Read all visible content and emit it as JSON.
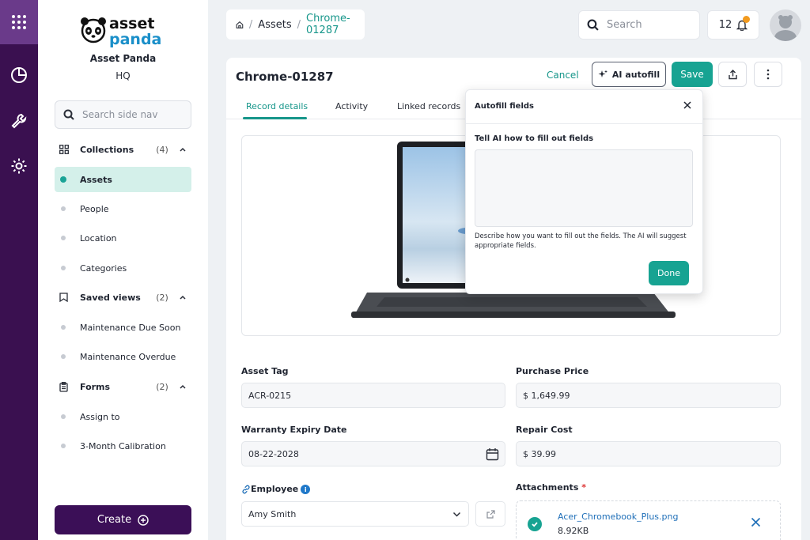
{
  "org": {
    "logo_line1": "asset",
    "logo_line2": "panda",
    "name": "Asset Panda",
    "location": "HQ"
  },
  "sidenav": {
    "search_placeholder": "Search side nav",
    "collections": {
      "label": "Collections",
      "count": "(4)"
    },
    "collection_items": [
      "Assets",
      "People",
      "Location",
      "Categories"
    ],
    "saved_views": {
      "label": "Saved views",
      "count": "(2)"
    },
    "saved_view_items": [
      "Maintenance Due Soon",
      "Maintenance Overdue"
    ],
    "forms": {
      "label": "Forms",
      "count": "(2)"
    },
    "form_items": [
      "Assign to",
      "3-Month Calibration"
    ],
    "create_label": "Create"
  },
  "breadcrumb": {
    "sep1": "/",
    "parent": "Assets",
    "sep2": "/",
    "current": "Chrome-01287"
  },
  "topbar": {
    "search_placeholder": "Search",
    "notification_count": "12"
  },
  "record": {
    "title": "Chrome-01287",
    "cancel_label": "Cancel",
    "ai_autofill_label": "AI autofill",
    "save_label": "Save",
    "tabs": [
      "Record details",
      "Activity",
      "Linked records"
    ]
  },
  "fields": {
    "asset_tag": {
      "label": "Asset Tag",
      "value": "ACR-0215"
    },
    "purchase_price": {
      "label": "Purchase Price",
      "value": "$ 1,649.99"
    },
    "warranty": {
      "label": "Warranty Expiry Date",
      "value": "08-22-2028"
    },
    "repair_cost": {
      "label": "Repair Cost",
      "value": "$ 39.99"
    },
    "employee": {
      "label": "Employee",
      "value": "Amy Smith"
    },
    "attachments": {
      "label": "Attachments",
      "required_mark": "*",
      "file_name": "Acer_Chromebook_Plus.png",
      "file_size": "8.92KB"
    }
  },
  "popover": {
    "title": "Autofill fields",
    "subtitle": "Tell AI how to fill out fields",
    "help": "Describe how you want to fill out the fields. The AI will suggest appropriate fields.",
    "done_label": "Done"
  },
  "colors": {
    "brand_purple": "#3a1050",
    "accent_teal": "#17a392",
    "notif_orange": "#f29a1e",
    "link_blue": "#1f6fb8"
  },
  "icons": [
    "apps-grid-icon",
    "pie-chart-icon",
    "wrench-icon",
    "gear-icon",
    "search-icon",
    "grid-icon",
    "bookmark-icon",
    "clipboard-icon",
    "chevron-up-icon",
    "plus-circle-icon",
    "home-icon",
    "bell-icon",
    "sparkle-icon",
    "share-icon",
    "more-vertical-icon",
    "close-icon",
    "calendar-icon",
    "link-icon",
    "info-icon",
    "external-link-icon",
    "chevron-down-icon",
    "check-icon"
  ]
}
